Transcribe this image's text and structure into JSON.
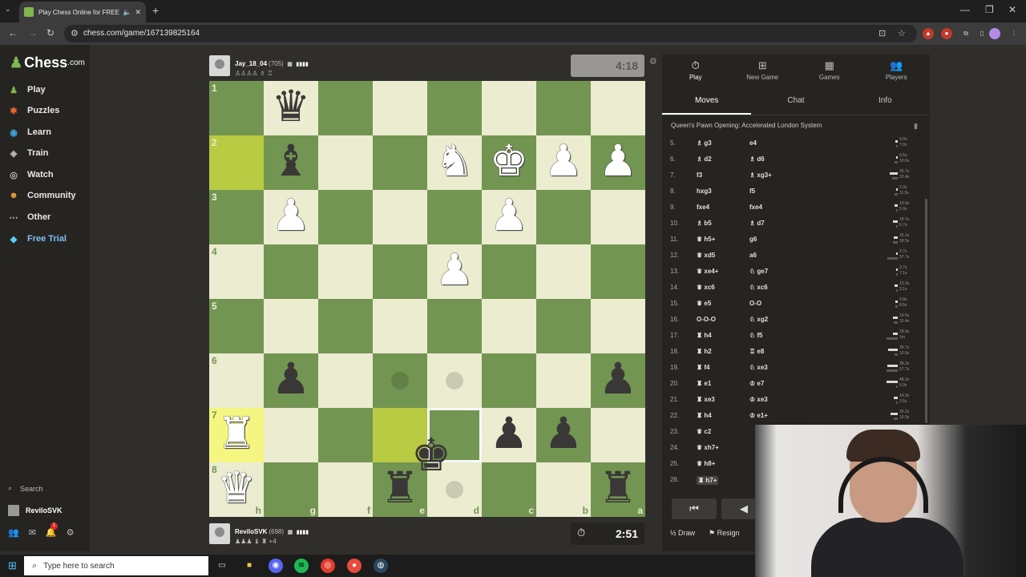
{
  "browser": {
    "tab_title": "Play Chess Online for FREE",
    "url": "chess.com/game/167139825164",
    "new_tab": "+",
    "tab_close": "✕"
  },
  "sidebar": {
    "logo": "Chess",
    "logo_suffix": ".com",
    "items": [
      {
        "label": "Play",
        "icon": "♟"
      },
      {
        "label": "Puzzles",
        "icon": "✱"
      },
      {
        "label": "Learn",
        "icon": "◉"
      },
      {
        "label": "Train",
        "icon": "◈"
      },
      {
        "label": "Watch",
        "icon": "◎"
      },
      {
        "label": "Community",
        "icon": "☻"
      },
      {
        "label": "Other",
        "icon": "⋯"
      },
      {
        "label": "Free Trial",
        "icon": "◆"
      }
    ],
    "search_label": "Search",
    "user_label": "ReviloSVK",
    "notification_count": "1"
  },
  "top_player": {
    "name": "Jay_18_04",
    "rating": "(705)",
    "captured": "♙♙♙♙ ♗ ♖"
  },
  "bottom_player": {
    "name": "ReviloSVK",
    "rating": "(698)",
    "captured": "♟♟♟ ♝ ♜",
    "advantage": "+4"
  },
  "clocks": {
    "top": "4:18",
    "bottom": "2:51"
  },
  "board": {
    "ranks": [
      "1",
      "2",
      "3",
      "4",
      "5",
      "6",
      "7",
      "8"
    ],
    "files": [
      "h",
      "g",
      "f",
      "e",
      "d",
      "c",
      "b",
      "a"
    ],
    "rows": [
      [
        "",
        "bq",
        "",
        "",
        "",
        "",
        "",
        ""
      ],
      [
        "",
        "bb",
        "",
        "",
        "wn",
        "wk",
        "wp",
        "wp"
      ],
      [
        "",
        "wp",
        "",
        "",
        "",
        "wp",
        "",
        ""
      ],
      [
        "",
        "",
        "",
        "",
        "wp",
        "",
        "",
        ""
      ],
      [
        "",
        "",
        "",
        "",
        "",
        "",
        "",
        ""
      ],
      [
        "",
        "bp",
        "",
        "",
        "",
        "",
        "",
        "bp"
      ],
      [
        "wr",
        "",
        "",
        "",
        "",
        "bp",
        "bp",
        ""
      ],
      [
        "wq",
        "",
        "",
        "br",
        "",
        "",
        "",
        "br"
      ]
    ],
    "dragging_piece": "bk"
  },
  "panel": {
    "tabs": [
      {
        "label": "Play",
        "icon": "⏱"
      },
      {
        "label": "New Game",
        "icon": "⊞"
      },
      {
        "label": "Games",
        "icon": "▦"
      },
      {
        "label": "Players",
        "icon": "👥"
      }
    ],
    "subtabs": [
      "Moves",
      "Chat",
      "Info"
    ],
    "opening": "Queen's Pawn Opening: Accelerated London System",
    "moves": [
      {
        "n": "5.",
        "w": "♗ g3",
        "b": "e4",
        "tw": "9.0s",
        "tb": "7.0s"
      },
      {
        "n": "6.",
        "w": "♗ d2",
        "b": "♗ d6",
        "tw": "6.5s",
        "tb": "10.6s"
      },
      {
        "n": "7.",
        "w": "f3",
        "b": "♗ xg3+",
        "tw": "30.7s",
        "tb": "22.4s"
      },
      {
        "n": "8.",
        "w": "hxg3",
        "b": "f5",
        "tw": "2.3s",
        "tb": "11.5s"
      },
      {
        "n": "9.",
        "w": "fxe4",
        "b": "fxe4",
        "tw": "10.9s",
        "tb": "5.9s"
      },
      {
        "n": "10.",
        "w": "♗ b5",
        "b": "♗ d7",
        "tw": "18.7s",
        "tb": "6.7s"
      },
      {
        "n": "11.",
        "w": "♛ h5+",
        "b": "g6",
        "tw": "15.1s",
        "tb": "18.5s"
      },
      {
        "n": "12.",
        "w": "♛ xd5",
        "b": "a6",
        "tw": "2.7s",
        "tb": "37.7s"
      },
      {
        "n": "13.",
        "w": "♛ xe4+",
        "b": "♘ ge7",
        "tw": "3.7s",
        "tb": "7.1s"
      },
      {
        "n": "14.",
        "w": "♛ xc6",
        "b": "♘ xc6",
        "tw": "12.3s",
        "tb": "3.1s"
      },
      {
        "n": "15.",
        "w": "♛ e5",
        "b": "O-O",
        "tw": "9.8s",
        "tb": "8.5s"
      },
      {
        "n": "16.",
        "w": "O-O-O",
        "b": "♘ xg2",
        "tw": "19.5s",
        "tb": "15.4s"
      },
      {
        "n": "17.",
        "w": "♜ h4",
        "b": "♘ f5",
        "tw": "18.9s",
        "tb": "1m"
      },
      {
        "n": "18.",
        "w": "♜ h2",
        "b": "♖ e8",
        "tw": "36.7s",
        "tb": "10.6s"
      },
      {
        "n": "19.",
        "w": "♜ f4",
        "b": "♘ xe3",
        "tw": "38.2s",
        "tb": "57.7s"
      },
      {
        "n": "20.",
        "w": "♜ e1",
        "b": "♔ e7",
        "tw": "48.2s",
        "tb": "5.0s"
      },
      {
        "n": "21.",
        "w": "♜ xe3",
        "b": "♔ xe3",
        "tw": "14.3s",
        "tb": "3.5s"
      },
      {
        "n": "22.",
        "w": "♜ h4",
        "b": "♔ e1+",
        "tw": "26.2s",
        "tb": "16.0s"
      },
      {
        "n": "23.",
        "w": "♛ c2",
        "b": "",
        "tw": "",
        "tb": ""
      },
      {
        "n": "24.",
        "w": "♛ xh7+",
        "b": "",
        "tw": "",
        "tb": ""
      },
      {
        "n": "25.",
        "w": "♛ h8+",
        "b": "",
        "tw": "",
        "tb": ""
      },
      {
        "n": "26.",
        "w": "♜ h7+",
        "b": "",
        "tw": "",
        "tb": ""
      }
    ],
    "controls": [
      "⏮",
      "◀"
    ],
    "draw_label": "Draw",
    "draw_icon": "½",
    "resign_label": "Resign",
    "resign_icon": "⚑"
  },
  "taskbar": {
    "search_placeholder": "Type here to search"
  }
}
